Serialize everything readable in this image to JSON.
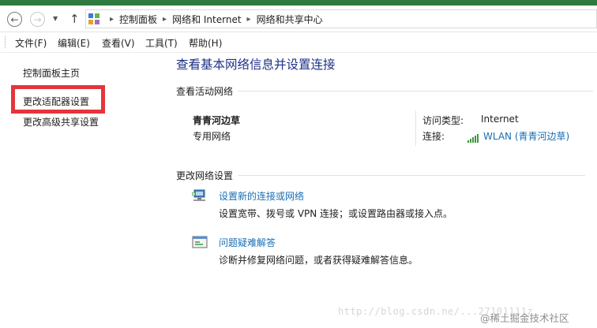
{
  "breadcrumb": [
    "控制面板",
    "网络和 Internet",
    "网络和共享中心"
  ],
  "menu": [
    "文件(F)",
    "编辑(E)",
    "查看(V)",
    "工具(T)",
    "帮助(H)"
  ],
  "sidebar": {
    "items": [
      {
        "label": "控制面板主页"
      },
      {
        "label": "更改适配器设置"
      },
      {
        "label": "更改高级共享设置"
      }
    ]
  },
  "main": {
    "title": "查看基本网络信息并设置连接",
    "active_section": "查看活动网络",
    "network_name": "青青河边草",
    "network_type": "专用网络",
    "access_type_label": "访问类型:",
    "access_type_value": "Internet",
    "connections_label": "连接:",
    "connections_value": "WLAN (青青河边草)",
    "change_section": "更改网络设置",
    "tasks": [
      {
        "link": "设置新的连接或网络",
        "desc": "设置宽带、拨号或 VPN 连接；或设置路由器或接入点。"
      },
      {
        "link": "问题疑难解答",
        "desc": "诊断并修复网络问题，或者获得疑难解答信息。"
      }
    ]
  },
  "watermark": {
    "url": "http://blog.csdn.ne/...27101111z",
    "site": "@稀土掘金技术社区"
  },
  "colors": {
    "accent_link": "#1a6eb3",
    "title": "#1e3287",
    "highlight_box": "#e4353b"
  },
  "icons": [
    "back-arrow-icon",
    "forward-arrow-icon",
    "up-arrow-icon",
    "control-panel-icon",
    "wifi-signal-icon",
    "new-connection-icon",
    "troubleshoot-icon"
  ]
}
